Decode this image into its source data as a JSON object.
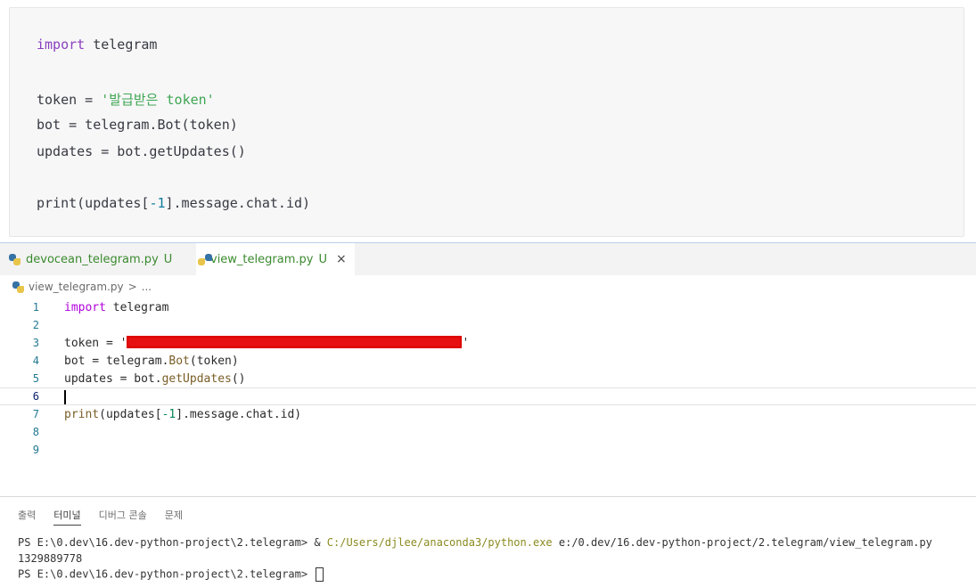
{
  "blog": {
    "line1_kw": "import",
    "line1_rest": " telegram",
    "line2_pre": "token = ",
    "line2_str": "'발급받은 token'",
    "line3": "bot = telegram.Bot(token)",
    "line4": "updates = bot.getUpdates()",
    "line5_pre": "print(updates[",
    "line5_num": "-1",
    "line5_post": "].message.chat.id)"
  },
  "tabs": [
    {
      "filename": "devocean_telegram.py",
      "status": "U"
    },
    {
      "filename": "view_telegram.py",
      "status": "U",
      "close": "×"
    }
  ],
  "breadcrumb": {
    "file": "view_telegram.py",
    "separator": ">",
    "rest": "..."
  },
  "editor": {
    "line_numbers": [
      "1",
      "2",
      "3",
      "4",
      "5",
      "6",
      "7",
      "8",
      "9"
    ],
    "l1_kw": "import",
    "l1_rest": " telegram",
    "l3_pre": "token = '",
    "l3_post": "'",
    "l4_pre": "bot = telegram.",
    "l4_fn": "Bot",
    "l4_post": "(token)",
    "l5_pre": "updates = bot.",
    "l5_fn": "getUpdates",
    "l5_post": "()",
    "l7_fn": "print",
    "l7_pre": "(updates[",
    "l7_num": "-1",
    "l7_post": "].message.chat.id)"
  },
  "panel": {
    "tabs": [
      "출력",
      "터미널",
      "디버그 콘솔",
      "문제"
    ],
    "active_tab": "터미널",
    "line1_prompt": "PS E:\\0.dev\\16.dev-python-project\\2.telegram> & ",
    "line1_path": "C:/Users/djlee/anaconda3/python.exe",
    "line1_arg": " e:/0.dev/16.dev-python-project/2.telegram/view_telegram.py",
    "line2": "1329889778",
    "line3_prompt": "PS E:\\0.dev\\16.dev-python-project\\2.telegram> "
  }
}
